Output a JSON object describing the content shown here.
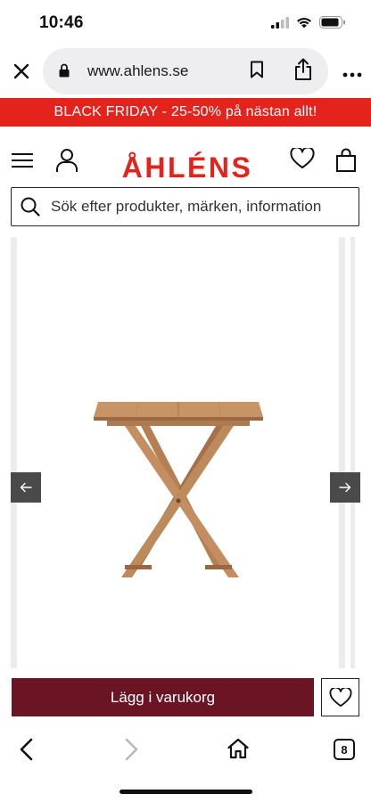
{
  "status_bar": {
    "time": "10:46"
  },
  "browser": {
    "url": "www.ahlens.se",
    "tab_count": "8"
  },
  "promo": {
    "text": "BLACK FRIDAY - 25-50% på nästan allt!"
  },
  "header": {
    "logo_text": "ÅHLÉNS",
    "brand_color": "#e4231c"
  },
  "search": {
    "placeholder": "Sök efter produkter, märken, information"
  },
  "product": {
    "add_to_cart_label": "Lägg i varukorg",
    "button_color": "#6b1424"
  }
}
